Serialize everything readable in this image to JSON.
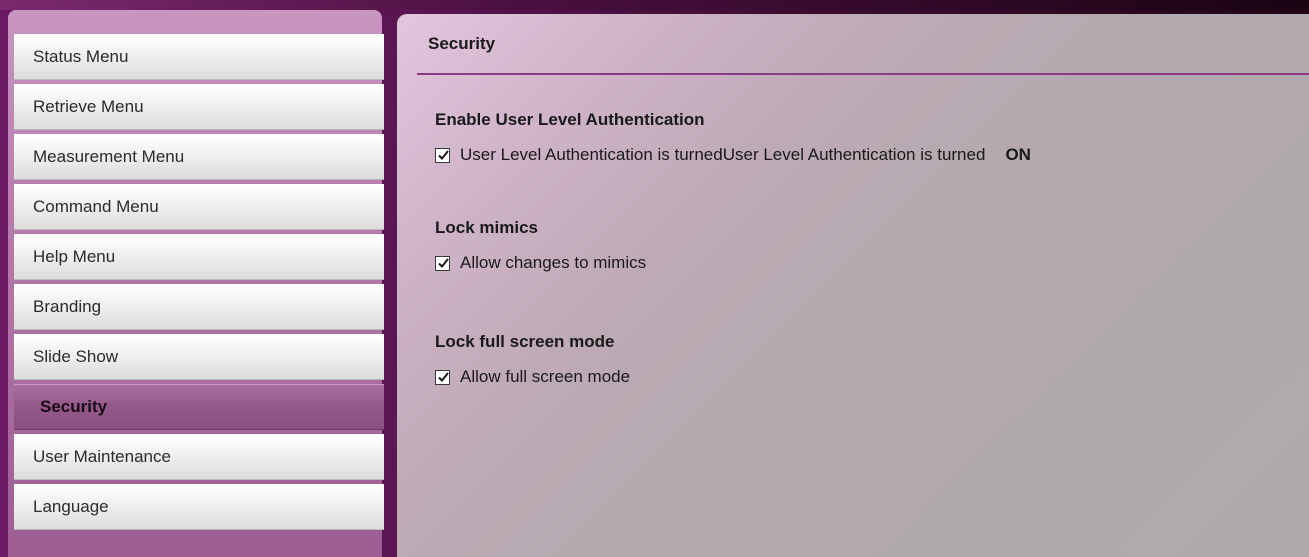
{
  "sidebar": {
    "items": [
      {
        "label": "Status Menu",
        "active": false
      },
      {
        "label": "Retrieve Menu",
        "active": false
      },
      {
        "label": "Measurement Menu",
        "active": false
      },
      {
        "label": "Command Menu",
        "active": false
      },
      {
        "label": "Help Menu",
        "active": false
      },
      {
        "label": "Branding",
        "active": false
      },
      {
        "label": "Slide Show",
        "active": false
      },
      {
        "label": "Security",
        "active": true
      },
      {
        "label": "User Maintenance",
        "active": false
      },
      {
        "label": "Language",
        "active": false
      }
    ]
  },
  "main": {
    "title": "Security",
    "sections": [
      {
        "heading": "Enable User Level Authentication",
        "checkbox_label": "User Level Authentication is turnedUser Level Authentication is turned",
        "status": "ON",
        "checked": true
      },
      {
        "heading": "Lock mimics",
        "checkbox_label": "Allow changes to mimics",
        "checked": true
      },
      {
        "heading": "Lock full screen mode",
        "checkbox_label": "Allow full screen mode",
        "checked": true
      }
    ]
  },
  "colors": {
    "accent": "#8b3a86",
    "active_menu": "#94598a"
  }
}
